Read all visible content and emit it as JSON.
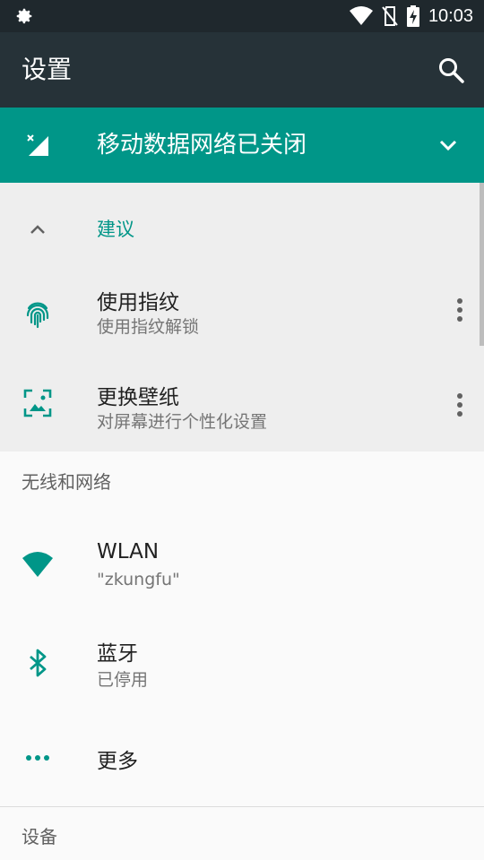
{
  "status_bar": {
    "time": "10:03"
  },
  "app_bar": {
    "title": "设置"
  },
  "banner": {
    "label": "移动数据网络已关闭"
  },
  "suggestions": {
    "header": "建议",
    "items": [
      {
        "title": "使用指纹",
        "subtitle": "使用指纹解锁",
        "icon": "fingerprint-icon"
      },
      {
        "title": "更换壁纸",
        "subtitle": "对屏幕进行个性化设置",
        "icon": "wallpaper-icon"
      }
    ]
  },
  "sections": [
    {
      "header": "无线和网络",
      "items": [
        {
          "title": "WLAN",
          "subtitle": "\"zkungfu\"",
          "icon": "wifi-icon"
        },
        {
          "title": "蓝牙",
          "subtitle": "已停用",
          "icon": "bluetooth-icon"
        },
        {
          "title": "更多",
          "icon": "more-horiz-icon"
        }
      ]
    },
    {
      "header": "设备"
    }
  ],
  "colors": {
    "accent": "#009688",
    "appbar": "#263238",
    "statusbar": "#1f282d"
  }
}
